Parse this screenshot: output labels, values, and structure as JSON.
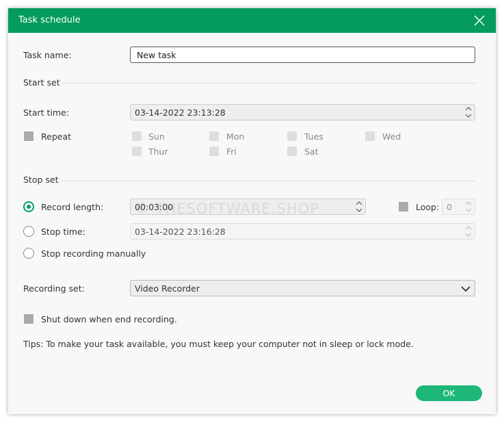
{
  "window": {
    "title": "Task schedule",
    "close_icon": "close-icon"
  },
  "task_name": {
    "label": "Task name:",
    "value": "New task"
  },
  "start_set": {
    "title": "Start set",
    "start_time_label": "Start time:",
    "start_time_value": "03-14-2022 23:13:28",
    "repeat_label": "Repeat",
    "days": [
      "Sun",
      "Mon",
      "Tues",
      "Wed",
      "Thur",
      "Fri",
      "Sat"
    ]
  },
  "stop_set": {
    "title": "Stop set",
    "record_length_label": "Record length:",
    "record_length_value": "00:03:00",
    "loop_label": "Loop:",
    "loop_value": "0",
    "stop_time_label": "Stop time:",
    "stop_time_value": "03-14-2022 23:16:28",
    "stop_manual_label": "Stop recording manually",
    "selected_option": "record-length"
  },
  "recording_set": {
    "label": "Recording set:",
    "value": "Video Recorder"
  },
  "shutdown": {
    "label": "Shut down when end recording."
  },
  "tips": "Tips: To make your task available, you must keep your computer not in sleep or lock mode.",
  "ok_label": "OK",
  "watermark": "© THESOFTWARE.SHOP",
  "colors": {
    "accent": "#039b5e",
    "ok_button": "#1db879",
    "radio": "#079e62"
  }
}
